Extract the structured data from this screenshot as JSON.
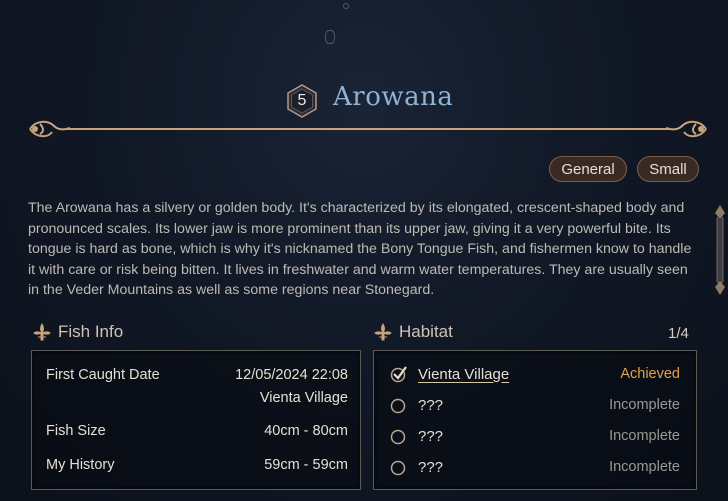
{
  "fish": {
    "rank": "5",
    "name": "Arowana",
    "tags": [
      "General",
      "Small"
    ],
    "description": "The Arowana has a silvery or golden body. It's characterized by its elongated, crescent-shaped body and pronounced scales. Its lower jaw is more prominent than its upper jaw, giving it a very powerful bite. Its tongue is hard as bone, which is why it's nicknamed the Bony Tongue Fish, and fishermen know to handle it with care or risk being bitten. It lives in freshwater and warm water temperatures. They are usually seen in the Veder Mountains as well as some regions near Stonegard."
  },
  "fish_info": {
    "heading": "Fish Info",
    "first_caught_label": "First Caught Date",
    "first_caught_date": "12/05/2024 22:08",
    "first_caught_place": "Vienta Village",
    "size_label": "Fish Size",
    "size_value": "40cm - 80cm",
    "history_label": "My History",
    "history_value": "59cm - 59cm"
  },
  "habitat": {
    "heading": "Habitat",
    "counter": "1/4",
    "items": [
      {
        "name": "Vienta Village",
        "status": "Achieved"
      },
      {
        "name": "???",
        "status": "Incomplete"
      },
      {
        "name": "???",
        "status": "Incomplete"
      },
      {
        "name": "???",
        "status": "Incomplete"
      }
    ]
  },
  "colors": {
    "title": "#8fb3d4",
    "achieved": "#e3a24a",
    "incomplete": "#9a9892",
    "ornament": "#c9a27e"
  },
  "icons": {
    "section": "fleur-de-lis-icon",
    "achieved": "checkmark-icon",
    "incomplete": "empty-circle-icon",
    "rank": "hexagon-badge-icon"
  }
}
